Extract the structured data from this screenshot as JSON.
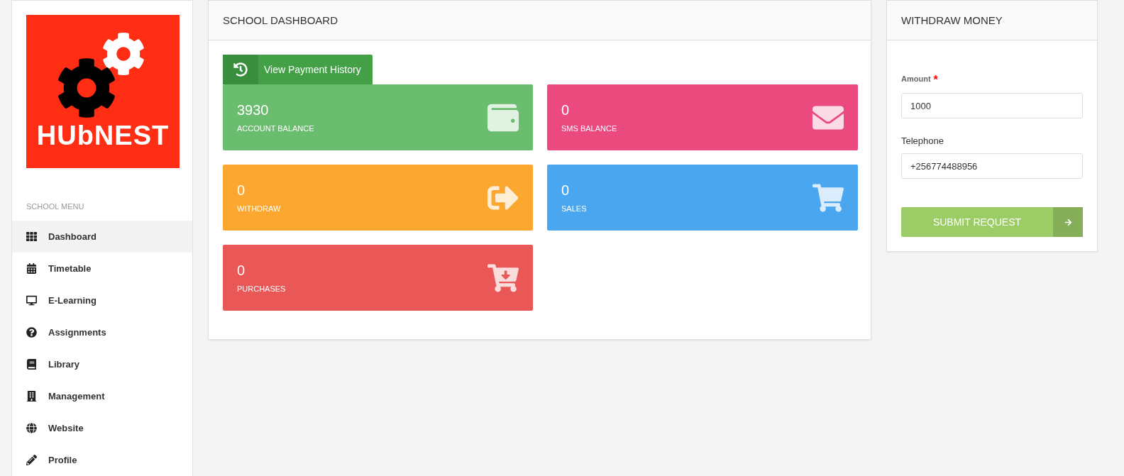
{
  "sidebar": {
    "logo_text": "HUbNEST",
    "menu_title": "SCHOOL MENU",
    "items": [
      {
        "label": "Dashboard",
        "kind": "grid",
        "selected": true
      },
      {
        "label": "Timetable",
        "kind": "calendar",
        "selected": false
      },
      {
        "label": "E-Learning",
        "kind": "monitor",
        "selected": false
      },
      {
        "label": "Assignments",
        "kind": "question",
        "selected": false
      },
      {
        "label": "Library",
        "kind": "books",
        "selected": false
      },
      {
        "label": "Management",
        "kind": "building",
        "selected": false
      },
      {
        "label": "Website",
        "kind": "globe",
        "selected": false
      },
      {
        "label": "Profile",
        "kind": "pencil",
        "selected": false
      }
    ]
  },
  "dashboard": {
    "title": "SCHOOL DASHBOARD",
    "history_button": "View Payment History",
    "tiles": [
      {
        "value": "3930",
        "label": "ACCOUNT BALANCE",
        "kind": "wallet",
        "color": "#6abd6e"
      },
      {
        "value": "0",
        "label": "SMS BALANCE",
        "kind": "mail",
        "color": "#ea4a7d"
      },
      {
        "value": "0",
        "label": "WITHDRAW",
        "kind": "exit",
        "color": "#fca830"
      },
      {
        "value": "0",
        "label": "SALES",
        "kind": "cart-up",
        "color": "#4aa6ef"
      },
      {
        "value": "0",
        "label": "PURCHASES",
        "kind": "cart-down",
        "color": "#ea5757"
      }
    ]
  },
  "withdraw": {
    "title": "WITHDRAW MONEY",
    "fields": [
      {
        "label": "Amount",
        "required_mark": "*",
        "value": "1000"
      },
      {
        "label": "Telephone",
        "value": "+256774488956"
      }
    ],
    "submit": "SUBMIT REQUEST"
  }
}
